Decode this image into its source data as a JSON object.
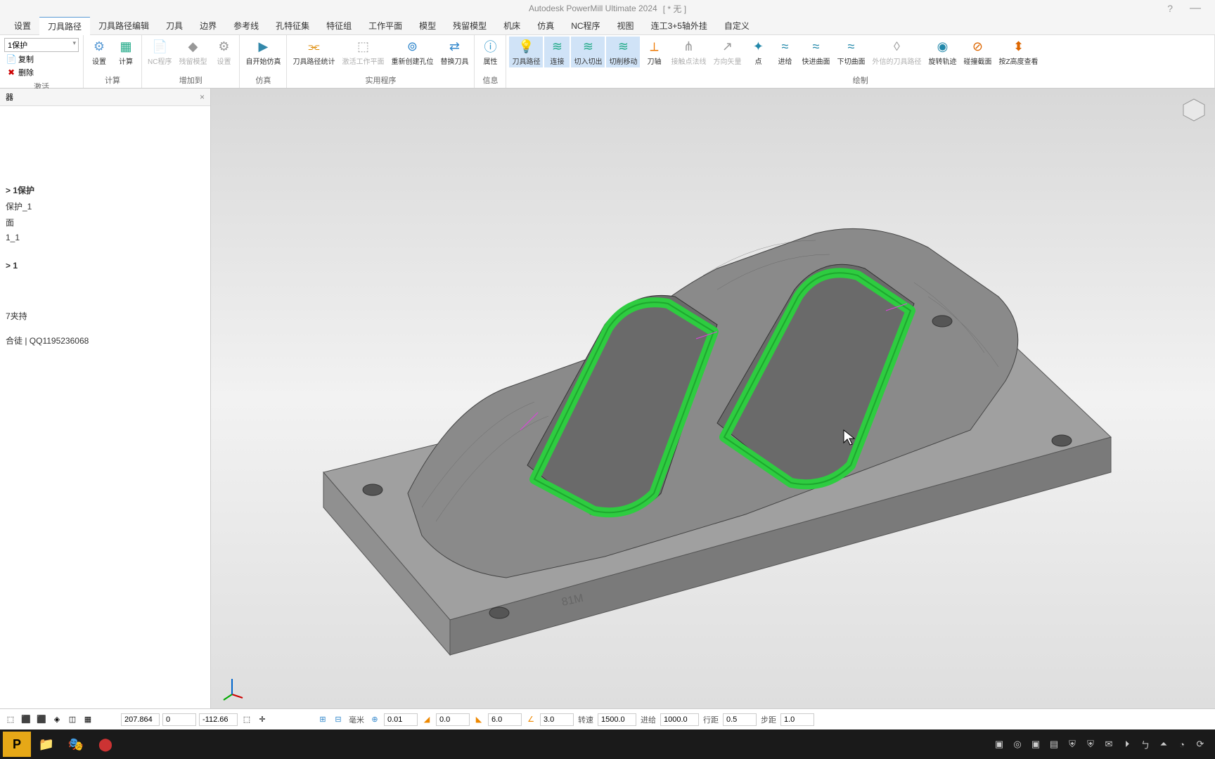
{
  "app": {
    "title": "Autodesk PowerMill Ultimate 2024",
    "doc_status": "[ * 无 ]"
  },
  "menu": {
    "items": [
      "设置",
      "刀具路径",
      "刀具路径编辑",
      "刀具",
      "边界",
      "参考线",
      "孔特征集",
      "特征组",
      "工作平面",
      "模型",
      "残留模型",
      "机床",
      "仿真",
      "NC程序",
      "视图",
      "连工3+5轴外挂",
      "自定义"
    ],
    "active_index": 1
  },
  "ribbon": {
    "dropdown_active": "1保护",
    "small_actions": [
      "复制",
      "删除"
    ],
    "groups": {
      "activate_label": "激活",
      "calculate_label": "计算",
      "addto_label": "增加到",
      "sim_label": "仿真",
      "utility_label": "实用程序",
      "info_label": "信息",
      "draw_label": "绘制"
    },
    "buttons": {
      "settings": "设置",
      "calculate": "计算",
      "nc_program": "NC程序",
      "residual_model": "残留模型",
      "settings2": "设置",
      "start_sim": "自开始仿真",
      "toolpath_stat": "刀具路径统计",
      "activate_wp": "激活工作平面",
      "recreate_hole": "重新创建孔位",
      "change_tool": "替换刀具",
      "properties": "属性",
      "toolpath": "刀具路径",
      "connect": "连接",
      "entry_exit": "切入切出",
      "cut_move": "切削移动",
      "tool_axis": "刀轴",
      "contact_normal": "接触点法线",
      "direction_vec": "方向矢量",
      "point": "点",
      "feed": "进给",
      "fast_curve": "快进曲面",
      "lower_curve": "下切曲面",
      "external_tp": "外信的刀具路径",
      "spiral": "旋转轨迹",
      "collision_sec": "碰撞截面",
      "viewport_check": "按Z高度查看"
    }
  },
  "side_panel": {
    "title": "器",
    "tree": {
      "item1": "> 1保护",
      "item2": "保护_1",
      "item3": "面",
      "item4": "1_1",
      "item5": "> 1",
      "item6": "7夹持",
      "item7": "合徒 | QQ1195236068"
    }
  },
  "viewport": {
    "model_text": "81M",
    "cursor_pos": "940,490"
  },
  "status": {
    "coord_x": "207.864",
    "coord_y": "0",
    "coord_z": "-112.66",
    "unit": "毫米",
    "tol_label": "",
    "tol": "0.01",
    "angle1": "0.0",
    "angle2": "6.0",
    "angle3": "3.0",
    "speed_label": "转速",
    "speed": "1500.0",
    "feed_label": "进给",
    "feed": "1000.0",
    "step_label": "行距",
    "step": "0.5",
    "step2_label": "步距",
    "step2": "1.0"
  },
  "taskbar": {
    "start_icon": "P",
    "tray_items": [
      "▣",
      "◎",
      "▣",
      "▤",
      "⛨",
      "⛨",
      "✉",
      "⏵",
      "ㄅ",
      "⏶",
      "◔",
      "⟳"
    ]
  },
  "colors": {
    "ribbon_active": "#5a9bd5",
    "toolpath_green": "#2ecc40",
    "model_gray": "#8a8a8a"
  }
}
